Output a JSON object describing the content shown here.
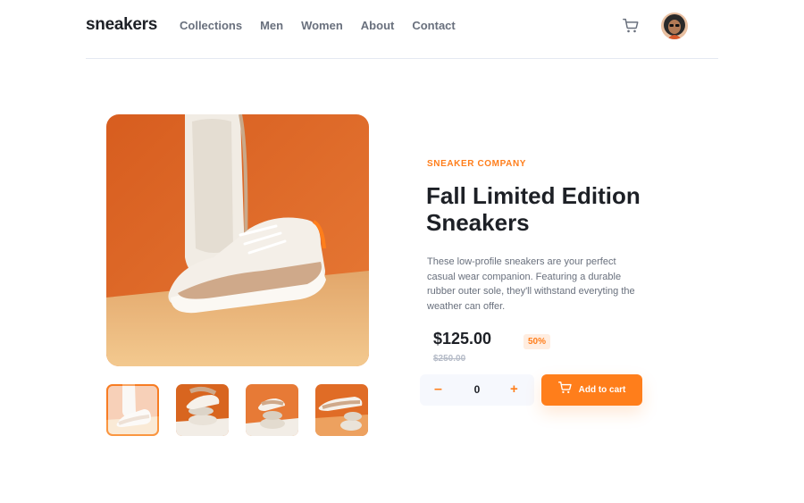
{
  "brand": {
    "logo": "sneakers",
    "accent": "#ff7e1b"
  },
  "nav": {
    "items": [
      {
        "label": "Collections"
      },
      {
        "label": "Men"
      },
      {
        "label": "Women"
      },
      {
        "label": "About"
      },
      {
        "label": "Contact"
      }
    ]
  },
  "header_icons": {
    "cart": "cart-icon",
    "avatar": "user-avatar"
  },
  "product": {
    "company": "SNEAKER COMPANY",
    "title": "Fall Limited Edition Sneakers",
    "description": "These low-profile sneakers are your perfect casual wear companion. Featuring a durable rubber outer sole, they'll withstand everyting the weather can offer.",
    "price": "$125.00",
    "discount": "50%",
    "old_price": "$250.00"
  },
  "cart_controls": {
    "minus": "–",
    "quantity": "0",
    "plus": "+",
    "add_label": "Add to cart"
  }
}
